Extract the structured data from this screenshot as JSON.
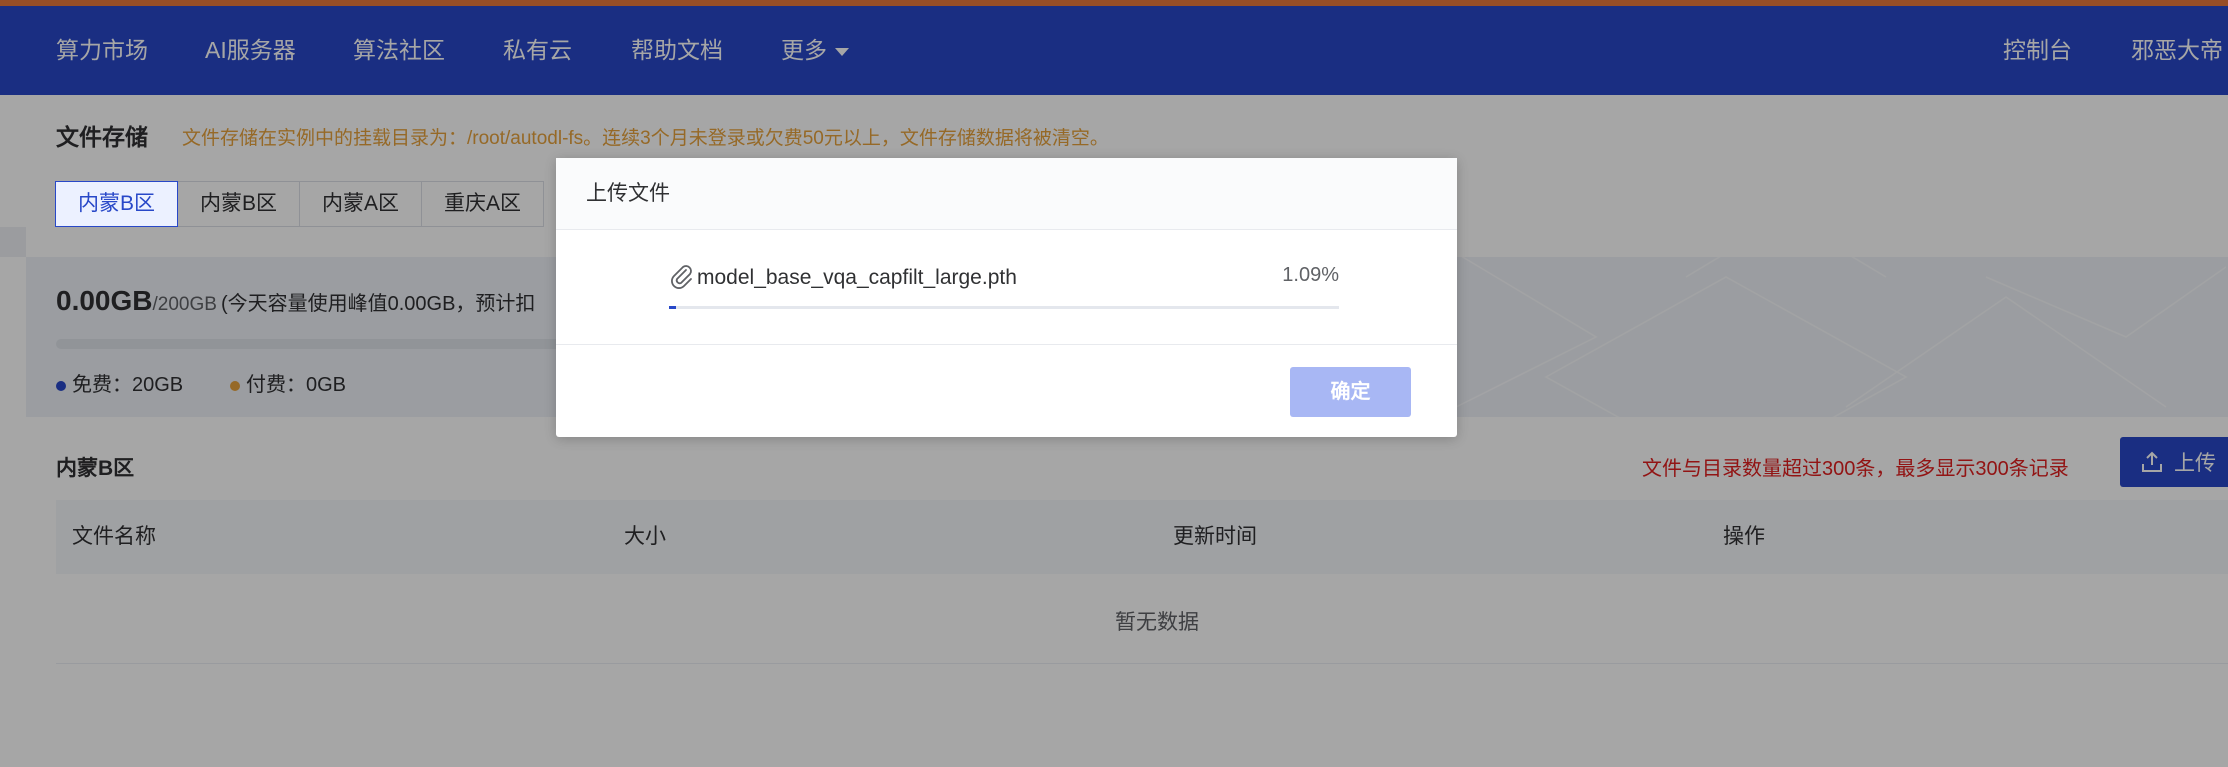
{
  "nav": {
    "items": [
      "算力市场",
      "AI服务器",
      "算法社区",
      "私有云",
      "帮助文档"
    ],
    "more": "更多",
    "console": "控制台",
    "user": "邪恶大帝"
  },
  "page": {
    "title": "文件存储",
    "notice": "文件存储在实例中的挂载目录为：/root/autodl-fs。连续3个月未登录或欠费50元以上，文件存储数据将被清空。",
    "region_tabs": [
      "内蒙B区",
      "内蒙B区",
      "内蒙A区",
      "重庆A区"
    ],
    "active_tab_index": 0
  },
  "usage": {
    "used": "0.00GB",
    "total": "/200GB",
    "note": "(今天容量使用峰值0.00GB，预计扣",
    "used_fraction": 0.0,
    "free_label": "免费：20GB",
    "paid_label": "付费：0GB",
    "free_color": "#2848c8",
    "paid_color": "#e6a23c"
  },
  "files": {
    "region_label": "内蒙B区",
    "limit_warning": "文件与目录数量超过300条，最多显示300条记录",
    "upload_label": "上传",
    "columns": [
      "文件名称",
      "大小",
      "更新时间",
      "操作"
    ],
    "empty_text": "暂无数据"
  },
  "dialog": {
    "title": "上传文件",
    "file_name": "model_base_vqa_capfilt_large.pth",
    "percent_text": "1.09%",
    "progress": 0.0109,
    "confirm_label": "确定"
  },
  "colors": {
    "brand": "#2848c8",
    "accent_stripe": "#e8793b",
    "warning": "#e6a23c",
    "danger": "#e02020"
  }
}
